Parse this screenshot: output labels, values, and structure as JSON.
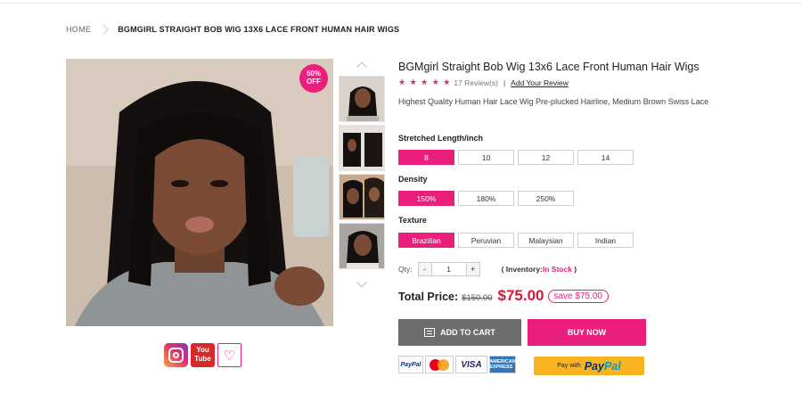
{
  "breadcrumb": {
    "home": "HOME",
    "current": "BGMGIRL STRAIGHT BOB WIG 13X6 LACE FRONT HUMAN HAIR WIGS"
  },
  "product": {
    "title": "BGMgirl Straight Bob Wig 13x6 Lace Front Human Hair Wigs",
    "stars": "★ ★ ★ ★ ★",
    "reviews": "17 Review(s)",
    "rating_separator": "|",
    "add_review": "Add Your Review",
    "description": "Highest Quality Human Hair Lace Wig Pre-plucked Hairline, Medium Brown Swiss Lace",
    "badge_line1": "50%",
    "badge_line2": "OFF"
  },
  "options": {
    "length": {
      "label": "Stretched Length/inch",
      "values": [
        "8",
        "10",
        "12",
        "14"
      ],
      "selected": "8"
    },
    "density": {
      "label": "Density",
      "values": [
        "150%",
        "180%",
        "250%"
      ],
      "selected": "150%"
    },
    "texture": {
      "label": "Texture",
      "values": [
        "Brazilian",
        "Peruvian",
        "Malaysian",
        "Indian"
      ],
      "selected": "Brazilian"
    }
  },
  "quantity": {
    "label": "Qty:",
    "minus": "-",
    "value": "1",
    "plus": "+",
    "inventory_prefix": "( Inventory:",
    "inventory_status": "In Stock",
    "inventory_suffix": " )"
  },
  "price": {
    "label": "Total Price:",
    "old": "$150.00",
    "new": "$75.00",
    "save": "save $75.00"
  },
  "actions": {
    "add_to_cart": "ADD TO CART",
    "buy_now": "BUY NOW"
  },
  "payment": {
    "paypal_card": "PayPal",
    "visa": "VISA",
    "amex": "AMERICAN EXPRESS",
    "paypal_with": "Pay with",
    "paypal_logo_a": "Pay",
    "paypal_logo_b": "Pal"
  },
  "social": {
    "youtube_a": "You",
    "youtube_b": "Tube",
    "wishlist": "♡"
  },
  "colors": {
    "accent": "#ea1f7d",
    "price_red": "#d01a3a",
    "cart_gray": "#6d6d6d",
    "paypal_yellow": "#f7b41f"
  }
}
